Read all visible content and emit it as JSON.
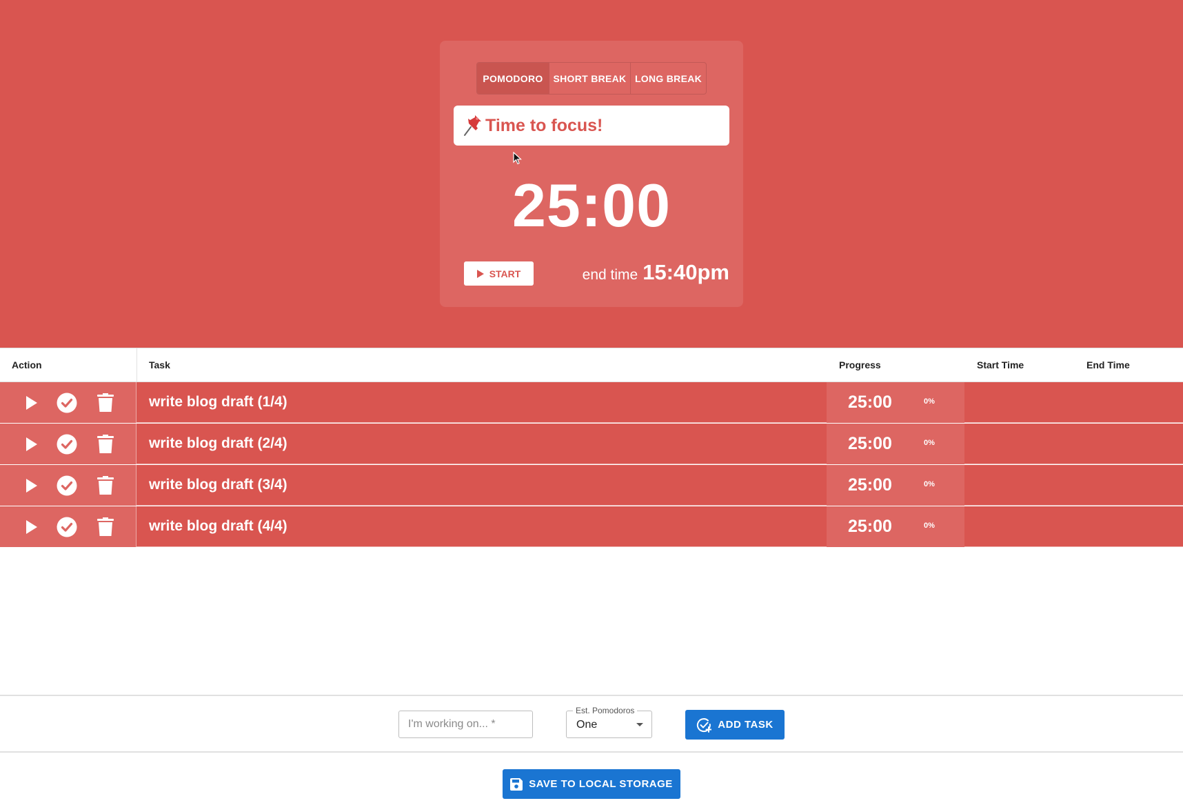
{
  "colors": {
    "accent": "#d95550",
    "card": "#dd6662",
    "primary_button": "#1a75d2"
  },
  "modes": [
    {
      "label": "POMODORO",
      "active": true
    },
    {
      "label": "SHORT BREAK",
      "active": false
    },
    {
      "label": "LONG BREAK",
      "active": false
    }
  ],
  "timer": {
    "message": "Time to focus!",
    "message_icon": "pushpin-icon",
    "time": "25:00",
    "start_label": "START",
    "end_label": "end time",
    "end_value": "15:40pm"
  },
  "table": {
    "headers": {
      "action": "Action",
      "task": "Task",
      "progress": "Progress",
      "start_time": "Start Time",
      "end_time": "End Time"
    },
    "rows": [
      {
        "task": "write blog draft (1/4)",
        "time": "25:00",
        "percent": "0%",
        "start_time": "",
        "end_time": ""
      },
      {
        "task": "write blog draft (2/4)",
        "time": "25:00",
        "percent": "0%",
        "start_time": "",
        "end_time": ""
      },
      {
        "task": "write blog draft (3/4)",
        "time": "25:00",
        "percent": "0%",
        "start_time": "",
        "end_time": ""
      },
      {
        "task": "write blog draft (4/4)",
        "time": "25:00",
        "percent": "0%",
        "start_time": "",
        "end_time": ""
      }
    ]
  },
  "form": {
    "task_placeholder": "I'm working on... *",
    "task_value": "",
    "est_label": "Est. Pomodoros",
    "est_value": "One",
    "add_label": "ADD TASK"
  },
  "save_label": "SAVE TO LOCAL STORAGE"
}
